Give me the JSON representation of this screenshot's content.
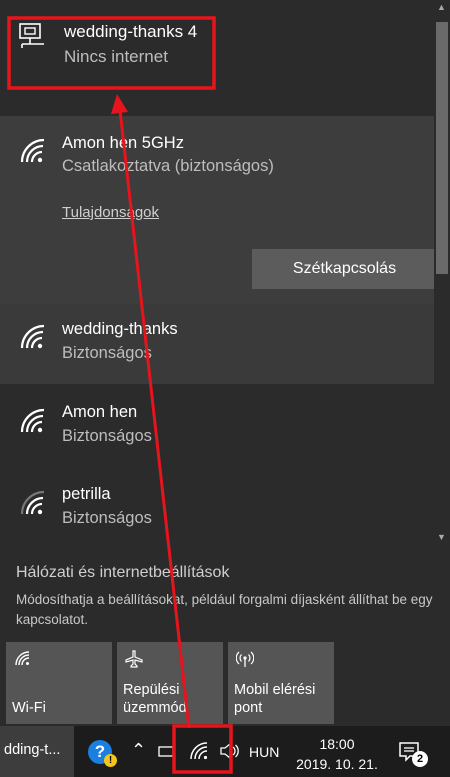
{
  "networks": {
    "ethernet": {
      "name": "wedding-thanks 4",
      "status": "Nincs internet",
      "icon": "ethernet-icon"
    },
    "connected": {
      "name": "Amon hen 5GHz",
      "status": "Csatlakoztatva (biztonságos)",
      "properties_label": "Tulajdonságok",
      "disconnect_label": "Szétkapcsolás",
      "icon": "wifi-signal-icon"
    },
    "available": [
      {
        "name": "wedding-thanks",
        "status": "Biztonságos",
        "icon": "wifi-signal-icon"
      },
      {
        "name": "Amon hen",
        "status": "Biztonságos",
        "icon": "wifi-signal-icon"
      },
      {
        "name": "petrilla",
        "status": "Biztonságos",
        "icon": "wifi-signal-weak-icon"
      }
    ]
  },
  "settings": {
    "link_label": "Hálózati és internetbeállítások",
    "description": "Módosíthatja a beállításokat, például forgalmi díjasként állíthat be egy kapcsolatot."
  },
  "quick_actions": [
    {
      "label_line1": "Wi-Fi",
      "label_line2": "",
      "icon": "wifi-icon"
    },
    {
      "label_line1": "Repülési",
      "label_line2": "üzemmód",
      "icon": "airplane-icon"
    },
    {
      "label_line1": "Mobil elérési",
      "label_line2": "pont",
      "icon": "hotspot-icon"
    }
  ],
  "taskbar": {
    "app_label": "dding-t...",
    "language": "HUN",
    "time": "18:00",
    "date": "2019. 10. 21.",
    "notification_count": "2"
  },
  "colors": {
    "annotation": "#e8141b",
    "help_blue": "#1a7fe0",
    "flyout_bg": "#2b2b2b",
    "selected_bg": "#3d3d3d"
  }
}
